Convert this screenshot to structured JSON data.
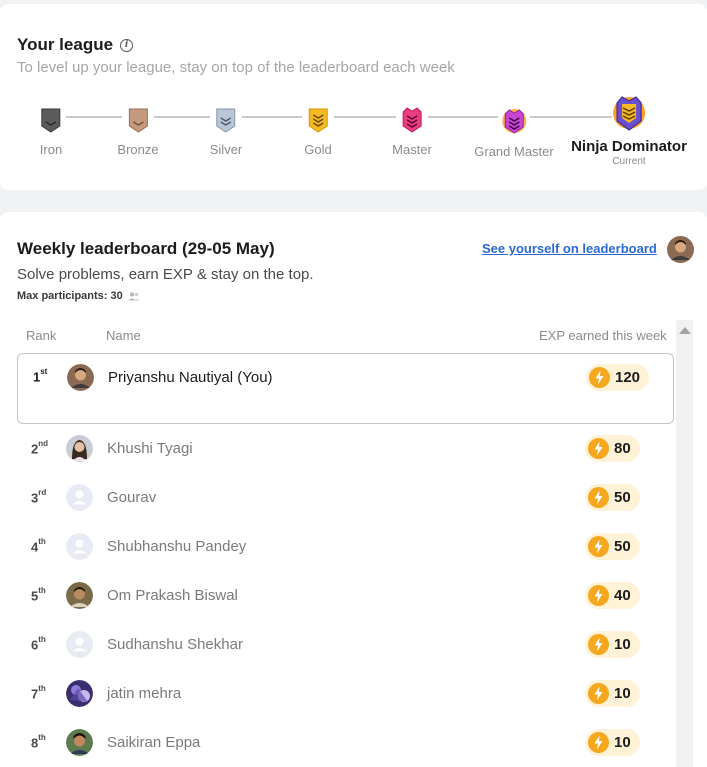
{
  "league": {
    "title": "Your league",
    "subtitle": "To level up your league, stay on top of the leaderboard each week",
    "tiers": [
      {
        "name": "Iron",
        "color": "#5b5b5b"
      },
      {
        "name": "Bronze",
        "color": "#b98a6d"
      },
      {
        "name": "Silver",
        "color": "#9fb0c2"
      },
      {
        "name": "Gold",
        "color": "#f2b21b"
      },
      {
        "name": "Master",
        "color": "#e8337a"
      },
      {
        "name": "Grand Master",
        "color": "#b23fc8"
      },
      {
        "name": "Ninja Dominator",
        "color": "#6a4fd1"
      }
    ],
    "current_label": "Current"
  },
  "board": {
    "title": "Weekly leaderboard (29-05 May)",
    "see_link": "See yourself on leaderboard",
    "subtitle": "Solve problems, earn EXP & stay on the top.",
    "max_participants": "Max participants: 30",
    "col_rank": "Rank",
    "col_name": "Name",
    "col_exp": "EXP earned this week",
    "rows": [
      {
        "rank": "1",
        "suffix": "st",
        "name": "Priyanshu Nautiyal (You)",
        "exp": "120"
      },
      {
        "rank": "2",
        "suffix": "nd",
        "name": "Khushi Tyagi",
        "exp": "80"
      },
      {
        "rank": "3",
        "suffix": "rd",
        "name": "Gourav",
        "exp": "50"
      },
      {
        "rank": "4",
        "suffix": "th",
        "name": "Shubhanshu Pandey",
        "exp": "50"
      },
      {
        "rank": "5",
        "suffix": "th",
        "name": "Om Prakash Biswal",
        "exp": "40"
      },
      {
        "rank": "6",
        "suffix": "th",
        "name": "Sudhanshu Shekhar",
        "exp": "10"
      },
      {
        "rank": "7",
        "suffix": "th",
        "name": "jatin mehra",
        "exp": "10"
      },
      {
        "rank": "8",
        "suffix": "th",
        "name": "Saikiran Eppa",
        "exp": "10"
      }
    ]
  },
  "colors": {
    "link": "#2b6ad6",
    "exp_badge": "#fff2d6",
    "bolt": "#f5a71d"
  }
}
